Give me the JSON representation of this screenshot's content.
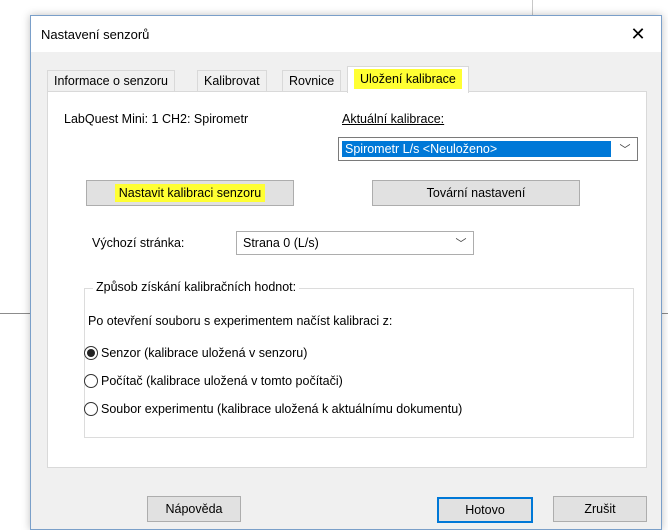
{
  "dialog": {
    "title": "Nastavení senzorů"
  },
  "tabs": [
    {
      "label": "Informace o senzoru",
      "active": false
    },
    {
      "label": "Kalibrovat",
      "active": false
    },
    {
      "label": "Rovnice",
      "active": false
    },
    {
      "label": "Uložení kalibrace",
      "active": true
    }
  ],
  "panel": {
    "sensor_label": "LabQuest Mini: 1 CH2: Spirometr",
    "current_calibration_label": "Aktuální kalibrace:",
    "current_calibration_value": "Spirometr L/s <Neuloženo>",
    "set_calibration_button": "Nastavit kalibraci senzoru",
    "factory_button": "Tovární nastavení",
    "default_page_label": "Výchozí stránka:",
    "default_page_value": "Strana 0 (L/s)",
    "group_label": "Způsob získání kalibračních hodnot:",
    "group_prompt": "Po otevření souboru s experimentem načíst kalibraci z:",
    "options": [
      {
        "label": "Senzor (kalibrace uložená v senzoru)",
        "selected": true
      },
      {
        "label": "Počítač (kalibrace uložená v tomto počítači)",
        "selected": false
      },
      {
        "label": "Soubor experimentu (kalibrace uložená k aktuálnímu dokumentu)",
        "selected": false
      }
    ]
  },
  "footer": {
    "help_button": "Nápověda",
    "done_button": "Hotovo",
    "cancel_button": "Zrušit"
  },
  "colors": {
    "highlight": "#ffff33",
    "selection": "#0078d7",
    "dialog_bg": "#f0f0f0"
  },
  "icons": {
    "close": "close-icon",
    "dropdown": "chevron-down-icon"
  }
}
